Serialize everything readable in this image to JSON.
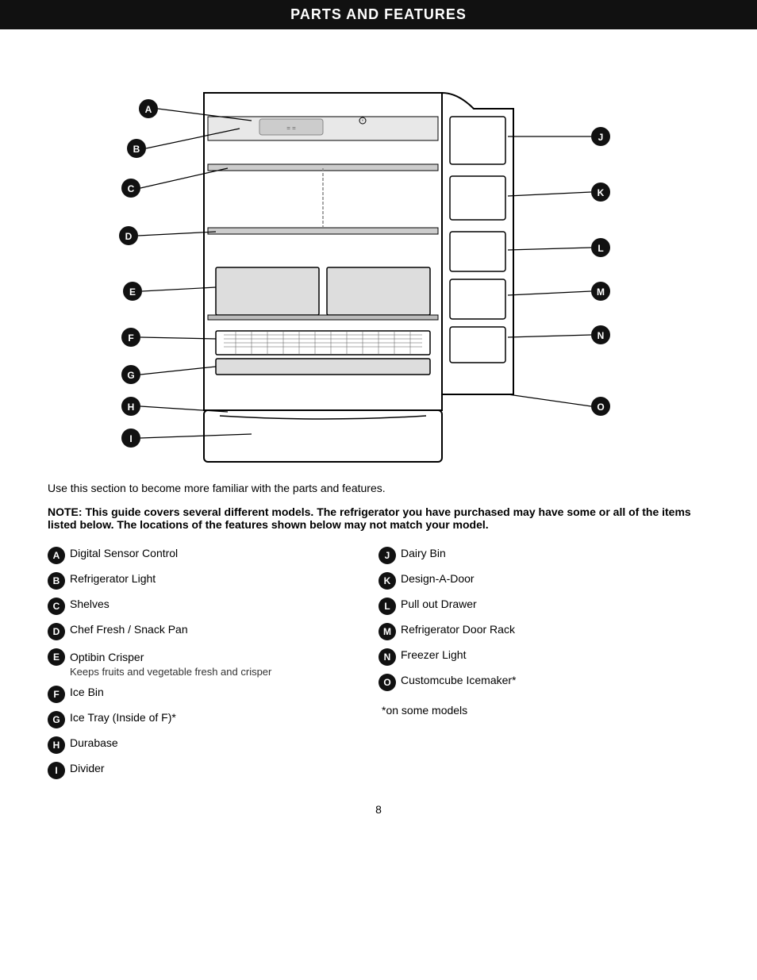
{
  "header": {
    "title": "PARTS AND FEATURES"
  },
  "intro": "Use this section to become more familiar with the parts and features.",
  "note": "NOTE: This guide covers several different models. The refrigerator you have purchased may have some or all of the items listed below. The locations of the features shown below may not match your model.",
  "left_features": [
    {
      "badge": "A",
      "label": "Digital Sensor Control",
      "sub": null
    },
    {
      "badge": "B",
      "label": "Refrigerator Light",
      "sub": null
    },
    {
      "badge": "C",
      "label": "Shelves",
      "sub": null
    },
    {
      "badge": "D",
      "label": "Chef Fresh / Snack Pan",
      "sub": null
    },
    {
      "badge": "E",
      "label": "Optibin Crisper",
      "sub": "Keeps fruits and vegetable fresh and crisper"
    },
    {
      "badge": "F",
      "label": "Ice Bin",
      "sub": null
    },
    {
      "badge": "G",
      "label": "Ice Tray (Inside of F)*",
      "sub": null
    },
    {
      "badge": "H",
      "label": "Durabase",
      "sub": null
    },
    {
      "badge": "I",
      "label": "Divider",
      "sub": null
    }
  ],
  "right_features": [
    {
      "badge": "J",
      "label": "Dairy Bin",
      "sub": null
    },
    {
      "badge": "K",
      "label": "Design-A-Door",
      "sub": null
    },
    {
      "badge": "L",
      "label": "Pull out Drawer",
      "sub": null
    },
    {
      "badge": "M",
      "label": "Refrigerator Door Rack",
      "sub": null
    },
    {
      "badge": "N",
      "label": "Freezer Light",
      "sub": null
    },
    {
      "badge": "O",
      "label": "Customcube Icemaker*",
      "sub": null
    }
  ],
  "on_some_models": "*on some models",
  "page_number": "8"
}
